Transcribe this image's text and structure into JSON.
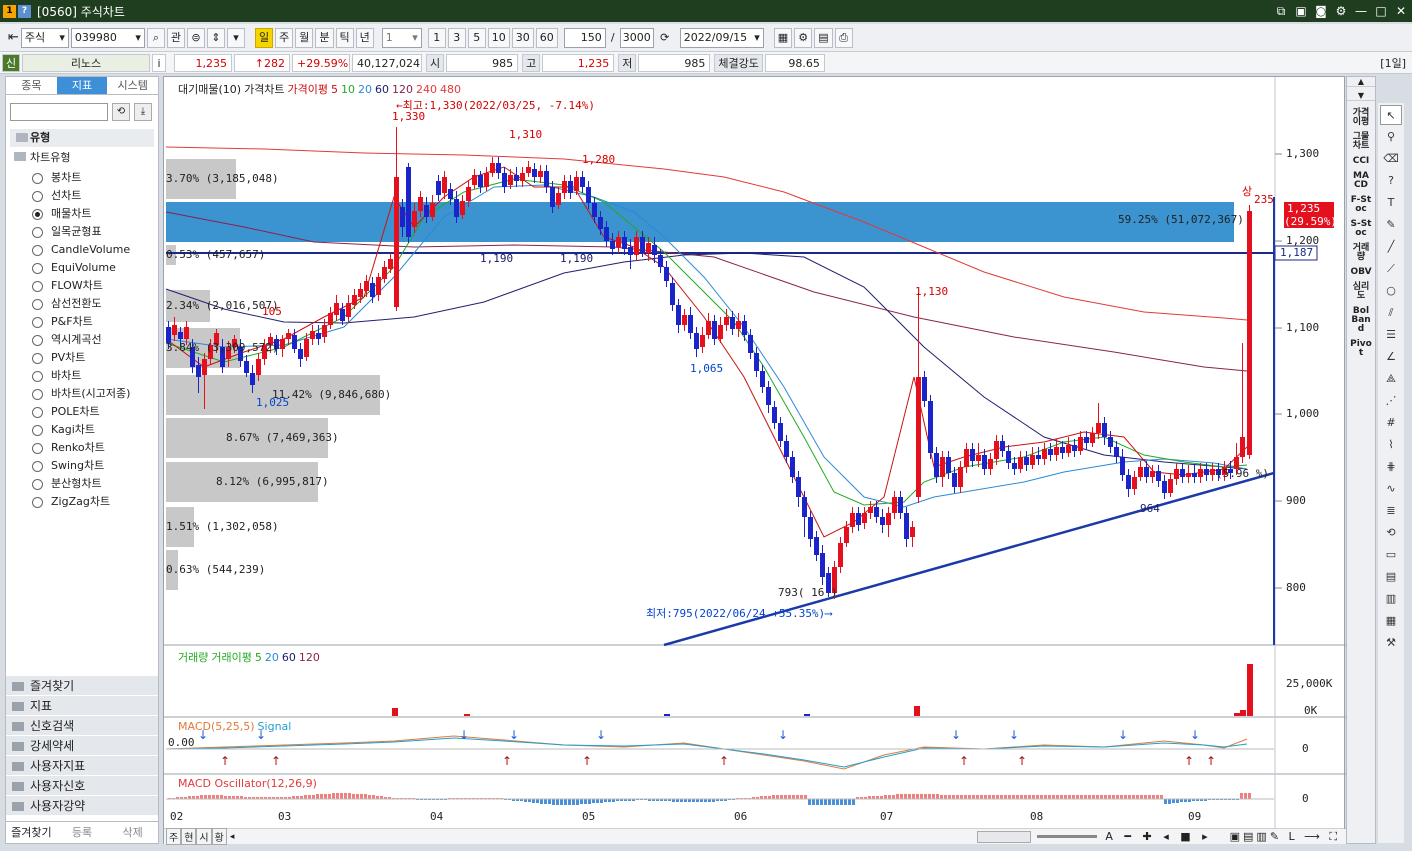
{
  "window": {
    "title": "[0560] 주식차트"
  },
  "toolbar": {
    "market": "주식",
    "code": "039980",
    "gwan": "관",
    "periods": [
      "일",
      "주",
      "월",
      "분",
      "틱",
      "년"
    ],
    "interval": "1",
    "quick": [
      "1",
      "3",
      "5",
      "10",
      "30",
      "60"
    ],
    "count": "150",
    "total": "3000",
    "date": "2022/09/15"
  },
  "quote": {
    "flag": "신",
    "name": "리노스",
    "info": "i",
    "price": "1,235",
    "change": "↑282",
    "rate": "+29.59%",
    "volume": "40,127,024",
    "open_label": "시",
    "open": "985",
    "high_label": "고",
    "high": "1,235",
    "low_label": "저",
    "low": "985",
    "strength_label": "체결강도",
    "strength": "98.65",
    "period_tag": "[1일]"
  },
  "sidebar": {
    "tabs": [
      "종목",
      "지표",
      "시스템"
    ],
    "section": "유형",
    "group": "차트유형",
    "types": [
      "봉차트",
      "선차트",
      "매물차트",
      "일목균형표",
      "CandleVolume",
      "EquiVolume",
      "FLOW차트",
      "삼선전환도",
      "P&F차트",
      "역시계곡선",
      "PV차트",
      "바차트",
      "바차트(시고저종)",
      "POLE차트",
      "Kagi차트",
      "Renko차트",
      "Swing차트",
      "분산형차트",
      "ZigZag차트"
    ],
    "selected_index": 2,
    "groups": [
      "즐겨찾기",
      "지표",
      "신호검색",
      "강세약세",
      "사용자지표",
      "사용자신호",
      "사용자강약"
    ],
    "bottom_tabs": [
      "즐겨찾기",
      "등록",
      "삭제"
    ]
  },
  "price_panel": {
    "legend": [
      "대기매물(10)",
      "가격차트",
      "가격이평",
      "5",
      "10",
      "20",
      "60",
      "120",
      "240",
      "480"
    ],
    "annotations": {
      "max": "←최고:1,330(2022/03/25, -7.14%)",
      "min": "최저:795(2022/06/24 +55.35%)⟶",
      "low_mark": "793( 16 )",
      "p1330": "1,330",
      "p1310": "1,310",
      "p1280": "1,280",
      "p1190a": "1,190",
      "p1190b": "1,190",
      "p1065": "1,065",
      "p1025": "1,025",
      "p1130": "1,130",
      "p964": "964",
      "p1105": "105",
      "p1235": "235",
      "sang": "상",
      "ma_pct": "(5.96 %)"
    },
    "volume_profile": [
      {
        "label": "3.70% (3,185,048)"
      },
      {
        "label": "59.25% (51,072,367)"
      },
      {
        "label": "0.53% (457,657)"
      },
      {
        "label": "2.34% (2,016,507)"
      },
      {
        "label": "3.84% (3,309,572)"
      },
      {
        "label": "11.42% (9,846,680)"
      },
      {
        "label": "8.67% (7,469,363)"
      },
      {
        "label": "8.12% (6,995,817)"
      },
      {
        "label": "1.51% (1,302,058)"
      },
      {
        "label": "0.63% (544,239)"
      }
    ],
    "yaxis": [
      "1,300",
      "1,200",
      "1,100",
      "1,000",
      "900",
      "800"
    ],
    "price_tag": "1,235",
    "rate_tag": "(29.59%)",
    "line_tag": "1,187"
  },
  "volume_panel": {
    "legend": [
      "거래량",
      "거래이평",
      "5",
      "20",
      "60",
      "120"
    ],
    "yaxis": [
      "25,000K",
      "0K"
    ]
  },
  "macd_panel": {
    "legend": [
      "MACD(5,25,5)",
      "Signal"
    ],
    "zero": "0.00",
    "yaxis": "0"
  },
  "osc_panel": {
    "legend": [
      "MACD Oscillator(12,26,9)"
    ],
    "yaxis": "0"
  },
  "xaxis": [
    "02",
    "03",
    "04",
    "05",
    "06",
    "07",
    "08",
    "09"
  ],
  "bottom_tabs": [
    "주",
    "현",
    "시",
    "황"
  ],
  "right_indicators": [
    "가격이평",
    "그물차트",
    "CCI",
    "MACD",
    "F-Stoc",
    "S-Stoc",
    "거래량",
    "OBV",
    "심리도",
    "Bol Band",
    "Pivot"
  ],
  "colors": {
    "up": "#e4101e",
    "down": "#1b24c8",
    "zone": "#3b93cf",
    "titlebar": "#1f3d1f"
  }
}
